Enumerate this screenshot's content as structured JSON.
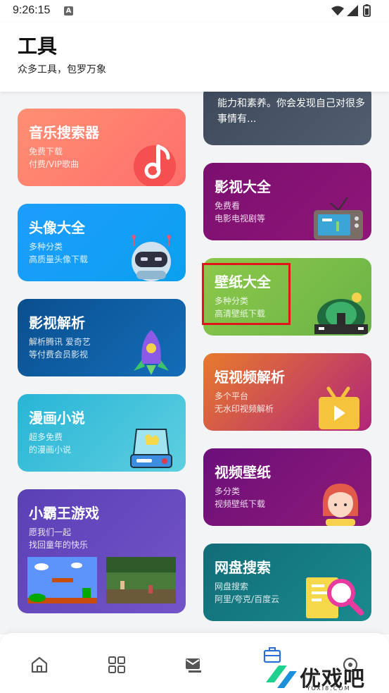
{
  "status_bar": {
    "time": "9:26:15",
    "notif_badge": "A"
  },
  "header": {
    "title": "工具",
    "subtitle": "众多工具，包罗万象"
  },
  "left_cards": [
    {
      "title": "音乐搜索器",
      "line1": "免费下载",
      "line2": "付费/VIP歌曲",
      "icon": "music-note-icon"
    },
    {
      "title": "头像大全",
      "line1": "多种分类",
      "line2": "高质量头像下载",
      "icon": "robot-icon"
    },
    {
      "title": "影视解析",
      "line1": "解析腾讯 爱奇艺",
      "line2": "等付费会员影视",
      "icon": "rocket-icon"
    },
    {
      "title": "漫画小说",
      "line1": "超多免费",
      "line2": "的漫画小说",
      "icon": "drive-icon"
    },
    {
      "title": "小霸王游戏",
      "line1": "愿我们一起",
      "line2": "找回童年的快乐",
      "icon": "game-screens"
    }
  ],
  "right_partial": {
    "text": "这一天不断充实自己，提升自己的能力和素养。你会发现自己对很多事情有..."
  },
  "right_cards": [
    {
      "title": "影视大全",
      "line1": "免费看",
      "line2": "电影电视剧等",
      "icon": "tv-icon"
    },
    {
      "title": "壁纸大全",
      "line1": "多种分类",
      "line2": "高清壁纸下载",
      "icon": "landscape-icon"
    },
    {
      "title": "短视频解析",
      "line1": "多个平台",
      "line2": "无水印视频解析",
      "icon": "play-tv-icon"
    },
    {
      "title": "视频壁纸",
      "line1": "多分类",
      "line2": "视频壁纸下载",
      "icon": "girl-avatar-icon"
    },
    {
      "title": "网盘搜索",
      "line1": "网盘搜索",
      "line2": "阿里/夸克/百度云",
      "icon": "search-doc-icon"
    }
  ],
  "bottom_nav": [
    {
      "name": "home-icon"
    },
    {
      "name": "apps-icon"
    },
    {
      "name": "message-icon"
    },
    {
      "name": "toolbox-icon"
    },
    {
      "name": "settings-icon"
    }
  ],
  "watermark": {
    "text": "优戏吧",
    "sub": "YOXI8.COM"
  },
  "colors": {
    "highlight": "#e0141a"
  }
}
